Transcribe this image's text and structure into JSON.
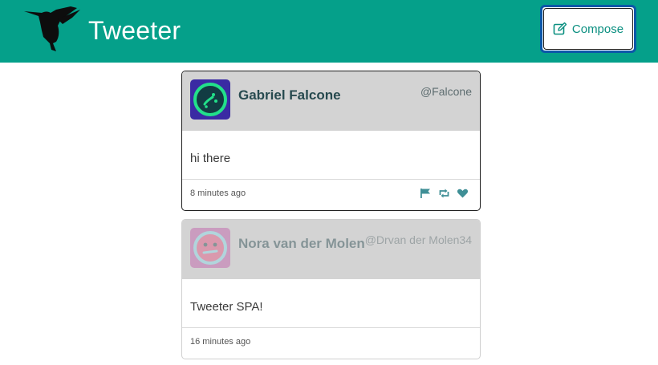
{
  "header": {
    "title": "Tweeter",
    "compose_label": "Compose",
    "logo_icon": "hummingbird-icon",
    "compose_icon": "edit-icon",
    "background": "#05a08a"
  },
  "tweets": [
    {
      "name": "Gabriel Falcone",
      "handle": "@Falcone",
      "text": "hi there",
      "time": "8 minutes ago",
      "avatar_icon": "avatar-icon",
      "actions": [
        "flag-icon",
        "retweet-icon",
        "heart-icon"
      ]
    },
    {
      "name": "Nora van der Molen",
      "handle": "@Drvan der Molen34",
      "text": "Tweeter SPA!",
      "time": "16 minutes ago",
      "avatar_icon": "avatar-icon"
    }
  ],
  "colors": {
    "accent": "#05a08a",
    "header_card": "#d3d3d3",
    "name_text": "#274a4f"
  }
}
